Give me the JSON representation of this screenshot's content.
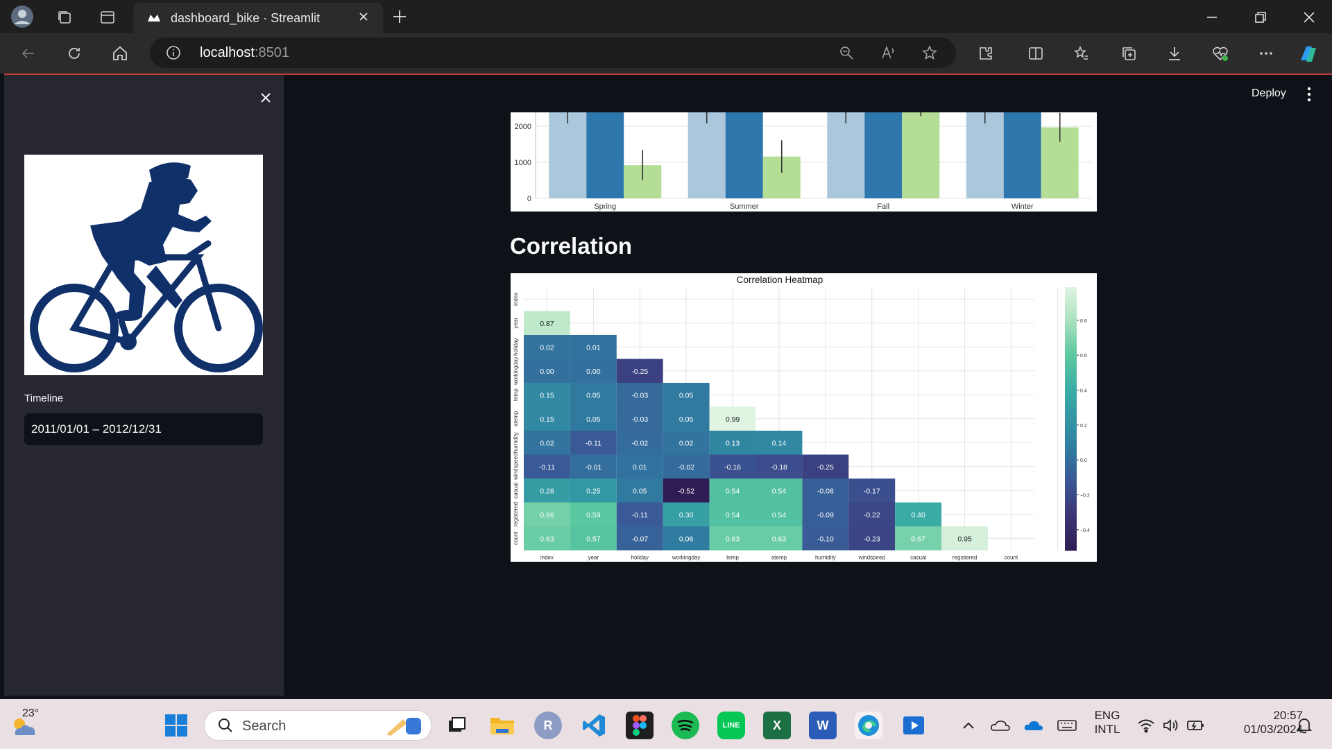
{
  "browser": {
    "tab_title": "dashboard_bike · Streamlit",
    "url_host": "localhost",
    "url_port": ":8501"
  },
  "sidebar": {
    "timeline_label": "Timeline",
    "timeline_value": "2011/01/01 – 2012/12/31"
  },
  "header": {
    "deploy_label": "Deploy"
  },
  "main": {
    "section_title": "Correlation"
  },
  "chart_data": [
    {
      "type": "bar",
      "categories": [
        "Spring",
        "Summer",
        "Fall",
        "Winter"
      ],
      "ylim": [
        0,
        2400
      ],
      "y_ticks": [
        0,
        1000,
        2000
      ],
      "series_colors": [
        "#aac7dc",
        "#2e77ad",
        "#b4de96"
      ],
      "series": [
        {
          "values": [
            2400,
            2400,
            2400,
            2400
          ]
        },
        {
          "values": [
            2400,
            2400,
            2400,
            2400
          ]
        },
        {
          "values": [
            920,
            1160,
            2400,
            1970
          ],
          "err": [
            420,
            450,
            120,
            400
          ]
        }
      ]
    },
    {
      "type": "heatmap",
      "title": "Correlation Heatmap",
      "labels": [
        "index",
        "year",
        "holiday",
        "workingday",
        "temp",
        "atemp",
        "humidity",
        "windspeed",
        "casual",
        "registered",
        "count"
      ],
      "matrix": [
        [
          null
        ],
        [
          0.87,
          null
        ],
        [
          0.02,
          0.01,
          null
        ],
        [
          -0.0,
          -0.0,
          -0.25,
          null
        ],
        [
          0.15,
          0.05,
          -0.03,
          0.05,
          null
        ],
        [
          0.15,
          0.05,
          -0.03,
          0.05,
          0.99,
          null
        ],
        [
          0.02,
          -0.11,
          -0.02,
          0.02,
          0.13,
          0.14,
          null
        ],
        [
          -0.11,
          -0.01,
          0.01,
          -0.02,
          -0.16,
          -0.18,
          -0.25,
          null
        ],
        [
          0.28,
          0.25,
          0.05,
          -0.52,
          0.54,
          0.54,
          -0.08,
          -0.17,
          null
        ],
        [
          0.66,
          0.59,
          -0.11,
          0.3,
          0.54,
          0.54,
          -0.09,
          -0.22,
          0.4,
          null
        ],
        [
          0.63,
          0.57,
          -0.07,
          0.06,
          0.63,
          0.63,
          -0.1,
          -0.23,
          0.67,
          0.95,
          null
        ]
      ],
      "colorbar_ticks": [
        0.8,
        0.6,
        0.4,
        0.2,
        0.0,
        -0.2,
        -0.4
      ],
      "colorbar_range": [
        -0.52,
        0.99
      ],
      "colormap": "mako"
    }
  ],
  "taskbar": {
    "weather_temp": "23°",
    "search_placeholder": "Search",
    "lang_line1": "ENG",
    "lang_line2": "INTL",
    "time": "20:57",
    "date": "01/03/2024"
  }
}
